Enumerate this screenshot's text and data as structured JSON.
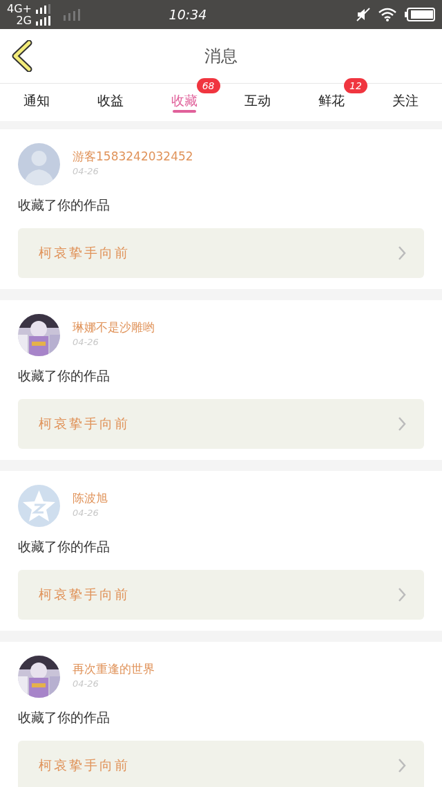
{
  "status_bar": {
    "network_1": "4G+",
    "network_2": "2G",
    "time": "10:34"
  },
  "header": {
    "title": "消息"
  },
  "tabs": [
    {
      "label": "通知",
      "selected": false
    },
    {
      "label": "收益",
      "selected": false
    },
    {
      "label": "收藏",
      "selected": true,
      "badge": "68"
    },
    {
      "label": "互动",
      "selected": false
    },
    {
      "label": "鲜花",
      "selected": false,
      "badge": "12"
    },
    {
      "label": "关注",
      "selected": false
    }
  ],
  "messages": [
    {
      "avatar": {
        "kind": "silhouette"
      },
      "name": "游客1583242032452",
      "date": "04-26",
      "text": "收藏了你的作品",
      "work": "柯哀挚手向前"
    },
    {
      "name": "琳娜不是沙雕哟",
      "date": "04-26",
      "text": "收藏了你的作品",
      "work": "柯哀挚手向前"
    },
    {
      "avatar": {
        "kind": "star"
      },
      "name": "陈波旭",
      "date": "04-26",
      "text": "收藏了你的作品",
      "work": "柯哀挚手向前"
    },
    {
      "name": "再次重逢的世界",
      "date": "04-26",
      "text": "收藏了你的作品",
      "work": "柯哀挚手向前"
    }
  ]
}
